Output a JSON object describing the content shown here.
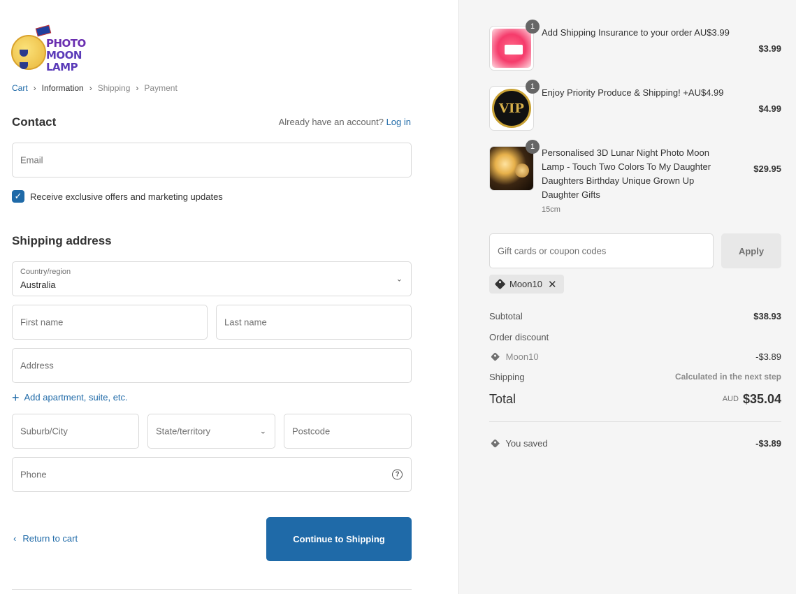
{
  "brand": {
    "logo_line1": "PHOTO",
    "logo_line2": "MOON LAMP"
  },
  "breadcrumb": {
    "cart": "Cart",
    "information": "Information",
    "shipping": "Shipping",
    "payment": "Payment"
  },
  "contact": {
    "heading": "Contact",
    "account_prompt": "Already have an account?",
    "login_label": "Log in",
    "email_placeholder": "Email",
    "marketing_label": "Receive exclusive offers and marketing updates",
    "marketing_checked": true
  },
  "shipping_address": {
    "heading": "Shipping address",
    "country_label": "Country/region",
    "country_value": "Australia",
    "first_name_placeholder": "First name",
    "last_name_placeholder": "Last name",
    "address_placeholder": "Address",
    "add_apartment_label": "Add apartment, suite, etc.",
    "city_placeholder": "Suburb/City",
    "state_placeholder": "State/territory",
    "postcode_placeholder": "Postcode",
    "phone_placeholder": "Phone"
  },
  "actions": {
    "return_label": "Return to cart",
    "continue_label": "Continue to Shipping"
  },
  "order": {
    "items": [
      {
        "name": "Add Shipping Insurance to your order AU$3.99",
        "variant": "",
        "quantity": "1",
        "price": "$3.99"
      },
      {
        "name": "Enjoy Priority Produce & Shipping! +AU$4.99",
        "variant": "",
        "quantity": "1",
        "price": "$4.99"
      },
      {
        "name": "Personalised 3D Lunar Night Photo Moon Lamp - Touch Two Colors To My Daughter Daughters Birthday Unique Grown Up Daughter Gifts",
        "variant": "15cm",
        "quantity": "1",
        "price": "$29.95"
      }
    ],
    "vip_text": "VIP",
    "coupon_placeholder": "Gift cards or coupon codes",
    "apply_label": "Apply",
    "applied_code": "Moon10",
    "subtotal_label": "Subtotal",
    "subtotal_value": "$38.93",
    "discount_label": "Order discount",
    "discount_code": "Moon10",
    "discount_value": "-$3.89",
    "shipping_label": "Shipping",
    "shipping_value": "Calculated in the next step",
    "total_label": "Total",
    "total_currency": "AUD",
    "total_value": "$35.04",
    "saved_label": "You saved",
    "saved_value": "-$3.89"
  },
  "colors": {
    "accent": "#1f6aa8",
    "sidebar_bg": "#f5f5f5"
  }
}
